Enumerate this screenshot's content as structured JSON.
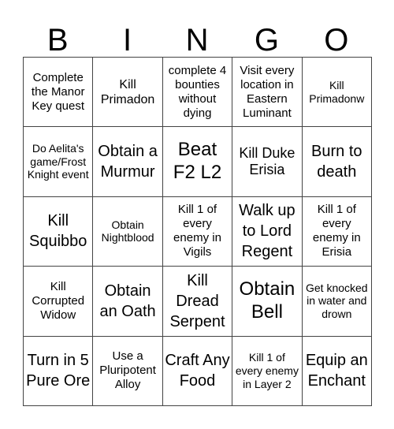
{
  "title_letters": [
    "B",
    "I",
    "N",
    "G",
    "O"
  ],
  "cells": [
    "Complete the Manor Key quest",
    "Kill Primadon",
    "complete 4 bounties without dying",
    "Visit every location in Eastern Luminant",
    "Kill Primadonw",
    "Do Aelita's game/Frost Knight event",
    "Obtain a Murmur",
    "Beat F2 L2",
    "Kill Duke Erisia",
    "Burn to death",
    "Kill Squibbo",
    "Obtain Nightblood",
    "Kill 1 of every enemy in Vigils",
    "Walk up to Lord Regent",
    "Kill 1 of every enemy in Erisia",
    "Kill Corrupted Widow",
    "Obtain an Oath",
    "Kill Dread Serpent",
    "Obtain Bell",
    "Get knocked in water and drown",
    "Turn in 5 Pure Ore",
    "Use a Pluripotent Alloy",
    "Craft Any Food",
    "Kill 1 of every enemy in Layer 2",
    "Equip an Enchant"
  ]
}
